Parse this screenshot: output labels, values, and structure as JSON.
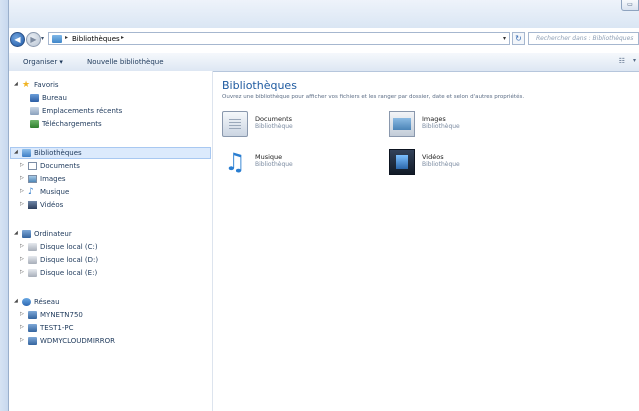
{
  "address_bar": {
    "breadcrumb": "Bibliothèques",
    "search_placeholder": "Rechercher dans : Bibliothèques"
  },
  "command_bar": {
    "organiser": "Organiser ▾",
    "new_library": "Nouvelle bibliothèque"
  },
  "nav": {
    "favoris": {
      "label": "Favoris",
      "items": [
        "Bureau",
        "Emplacements récents",
        "Téléchargements"
      ]
    },
    "libraries": {
      "label": "Bibliothèques",
      "items": [
        "Documents",
        "Images",
        "Musique",
        "Vidéos"
      ]
    },
    "computer": {
      "label": "Ordinateur",
      "items": [
        "Disque local (C:)",
        "Disque local (D:)",
        "Disque local (E:)"
      ]
    },
    "network": {
      "label": "Réseau",
      "items": [
        "MYNETN750",
        "TEST1-PC",
        "WDMYCLOUDMIRROR"
      ]
    }
  },
  "content": {
    "title": "Bibliothèques",
    "subtitle": "Ouvrez une bibliothèque pour afficher vos fichiers et les ranger par dossier, date et selon d'autres propriétés.",
    "tiles": [
      {
        "name": "Documents",
        "type": "Bibliothèque",
        "icon": "documents-library-icon"
      },
      {
        "name": "Images",
        "type": "Bibliothèque",
        "icon": "images-library-icon"
      },
      {
        "name": "Musique",
        "type": "Bibliothèque",
        "icon": "music-library-icon"
      },
      {
        "name": "Vidéos",
        "type": "Bibliothèque",
        "icon": "videos-library-icon"
      }
    ]
  }
}
